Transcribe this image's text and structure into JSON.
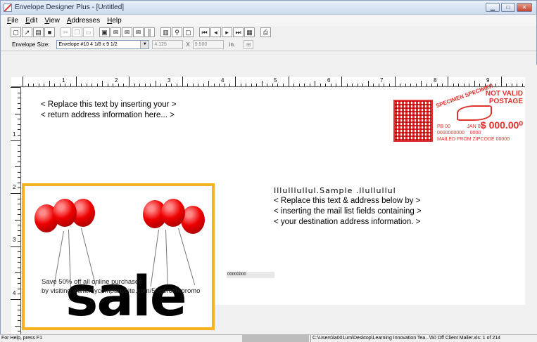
{
  "window": {
    "title": "Envelope Designer Plus - [Untitled]",
    "buttons": {
      "minimize": "▁",
      "maximize": "□",
      "close": "✕"
    }
  },
  "menu": [
    {
      "key": "F",
      "rest": "ile"
    },
    {
      "key": "E",
      "rest": "dit"
    },
    {
      "key": "V",
      "rest": "iew"
    },
    {
      "key": "A",
      "rest": "ddresses"
    },
    {
      "key": "H",
      "rest": "elp"
    }
  ],
  "toolbar": {
    "icons": [
      "new-icon",
      "open-icon",
      "print-preview-icon",
      "save-icon",
      "cut-icon",
      "copy-icon",
      "paste-icon",
      "image-icon",
      "envelope-icon",
      "envelope-address-icon",
      "envelope-return-icon",
      "barcode-icon",
      "layout-icon",
      "zoom-icon",
      "fit-icon",
      "first-record-icon",
      "prev-record-icon",
      "next-record-icon",
      "last-record-icon",
      "database-icon",
      "printer-icon"
    ]
  },
  "sizebar": {
    "label": "Envelope Size:",
    "selected": "Envelope #10 4 1/8 x 9 1/2",
    "width": "4.125",
    "x_sep": "X",
    "height": "9.500",
    "unit": "in."
  },
  "ruler": {
    "top_numbers": [
      "1",
      "2",
      "3",
      "4",
      "5",
      "6",
      "7",
      "8",
      "9"
    ],
    "left_numbers": [
      "1",
      "2",
      "3",
      "4"
    ]
  },
  "return_address": {
    "line1": "< Replace this text by inserting your >",
    "line2": "< return address information here... >"
  },
  "stamp": {
    "not_valid": "NOT VALID",
    "postage": "POSTAGE",
    "specimen": "SPECIMEN SPECIMEN",
    "pb_line1": "PB  00",
    "pb_line2": "0000000000",
    "date_line1": "JAN 00",
    "date_line2": "0000",
    "amount": "$ 000.00⁰",
    "mailed_from": "MAILED FROM ZIPCODE 00000"
  },
  "destination": {
    "barcode": "Illulllullul.Sample .llullullul",
    "line1": "< Replace this text & address below by  >",
    "line2": "< inserting the mail list fields containing  >",
    "line3": "< your destination address information.   >"
  },
  "ad": {
    "line1": "Save 50% off all online purchases",
    "line2": "by visiting www.mycompanysite.com/50percentpromo",
    "sale": "sale"
  },
  "barcode_field": "00000000",
  "status": {
    "help": "For Help, press F1",
    "path": "C:\\Users\\la001um\\Desktop\\Learning Innovation Tea...\\50 Off Client Mailer.xls: 1 of 214"
  },
  "colors": {
    "stamp_red": "#e0312a",
    "ad_border": "#f5b324"
  }
}
